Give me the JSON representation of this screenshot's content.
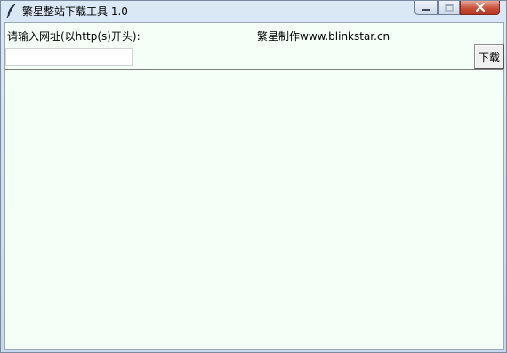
{
  "window": {
    "title": "繁星整站下载工具 1.0",
    "icon": "feather-icon",
    "controls": [
      "minimize-icon",
      "maximize-icon",
      "close-icon"
    ],
    "close_color": "#c64a33"
  },
  "form": {
    "url_label": "请输入网址(以http(s)开头):",
    "credit": "繁星制作www.blinkstar.cn",
    "url_value": "",
    "download_label": "下载"
  },
  "colors": {
    "client_background": "#f4fff8"
  }
}
